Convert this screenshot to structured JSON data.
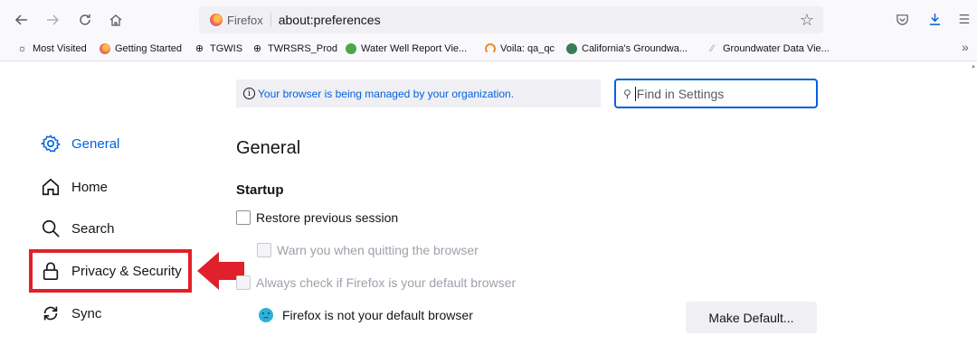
{
  "toolbar": {
    "back_icon": "back-arrow-icon",
    "forward_icon": "forward-arrow-icon",
    "reload_icon": "reload-icon",
    "home_icon": "home-icon",
    "identity_label": "Firefox",
    "url": "about:preferences",
    "bookmark_star_icon": "star-icon",
    "right_icons": [
      "pocket-icon",
      "downloads-icon",
      "menu-icon"
    ]
  },
  "bookmarks": [
    {
      "label": "Most Visited",
      "icon": "gear-icon"
    },
    {
      "label": "Getting Started",
      "icon": "firefox-icon"
    },
    {
      "label": "TGWIS",
      "icon": "globe-icon"
    },
    {
      "label": "TWRSRS_Prod",
      "icon": "globe-icon"
    },
    {
      "label": "Water Well Report Vie...",
      "icon": "site-icon"
    },
    {
      "label": "Voila: qa_qc",
      "icon": "voila-icon"
    },
    {
      "label": "California's Groundwa...",
      "icon": "site-icon"
    },
    {
      "label": "Groundwater Data Vie...",
      "icon": "feather-icon"
    }
  ],
  "bookmarks_overflow": "»",
  "managed_notice": "Your browser is being managed by your organization.",
  "search": {
    "placeholder": "Find in Settings",
    "value": ""
  },
  "categories": [
    {
      "label": "General",
      "icon": "gear-icon",
      "selected": true
    },
    {
      "label": "Home",
      "icon": "home-icon",
      "selected": false
    },
    {
      "label": "Search",
      "icon": "search-icon",
      "selected": false
    },
    {
      "label": "Privacy & Security",
      "icon": "lock-icon",
      "selected": false
    },
    {
      "label": "Sync",
      "icon": "sync-icon",
      "selected": false
    }
  ],
  "main": {
    "title": "General",
    "startup_heading": "Startup",
    "restore_session": "Restore previous session",
    "warn_quit": "Warn you when quitting the browser",
    "always_check": "Always check if Firefox is your default browser",
    "not_default": "Firefox is not your default browser",
    "make_default_button": "Make Default..."
  },
  "colors": {
    "accent": "#0061e0",
    "annotation_red": "#e0202a"
  }
}
